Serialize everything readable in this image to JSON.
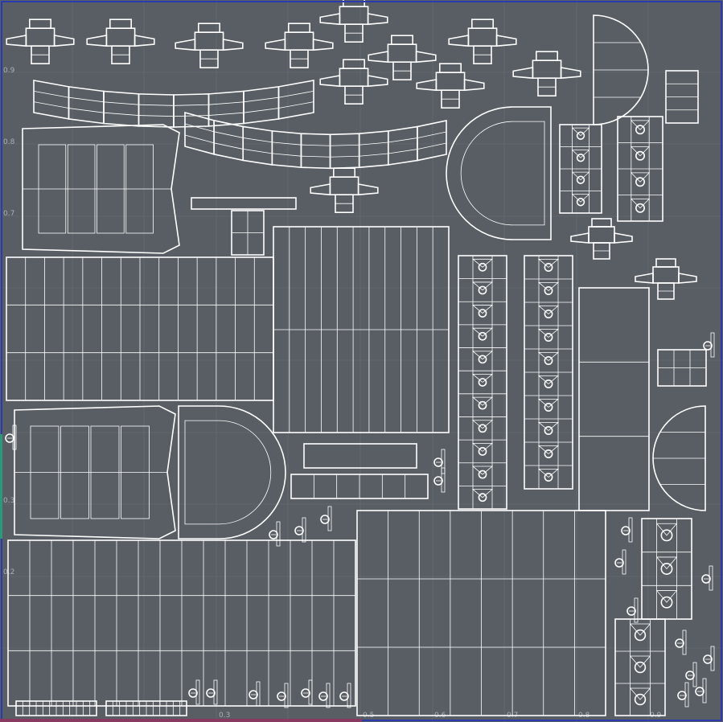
{
  "viewer": {
    "background_color": "#585e63",
    "wire_color": "#ffffff",
    "grid_color": "#6a7178",
    "frame_color": "#2a3bb0"
  },
  "axis": {
    "v_labels": [
      "0.9",
      "0.8",
      "0.7",
      "0.3",
      "0.2"
    ],
    "u_labels": [
      "0.3",
      "0.5",
      "0.6",
      "0.7",
      "0.8",
      "0.9"
    ]
  }
}
